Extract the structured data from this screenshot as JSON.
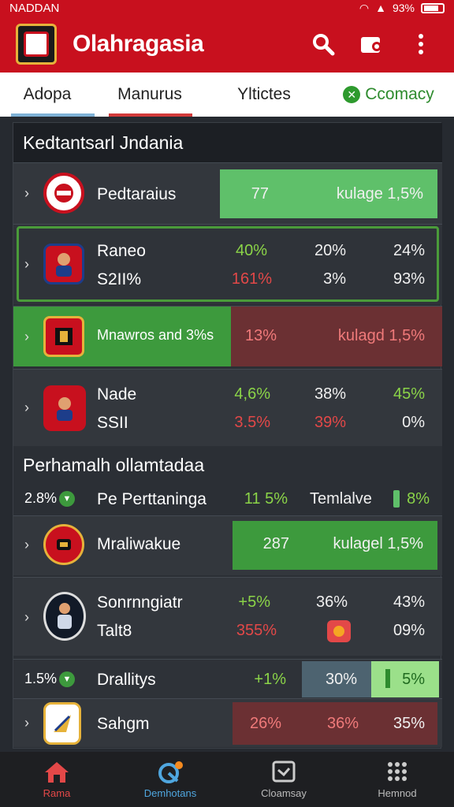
{
  "status": {
    "carrier": "NADDAN",
    "battery": "93%"
  },
  "app": {
    "title": "Olahragasia"
  },
  "tabs": [
    "Adopa",
    "Manurus",
    "Yltictes",
    "Ccomacy"
  ],
  "sections": [
    {
      "title": "Kedtantsarl Jndania"
    },
    {
      "title": "Perhamalh ollamtadaa"
    }
  ],
  "rows": {
    "r1": {
      "name": "Pedtaraius",
      "v1": "77",
      "v2": "kulage 1,5%"
    },
    "r2": {
      "name": "Raneo",
      "sub": "S2II%",
      "v1": "40%",
      "v2": "20%",
      "v3": "24%",
      "w1": "161%",
      "w2": "3%",
      "w3": "93%"
    },
    "r3": {
      "name": "Mnawros and 3%s",
      "v1": "13%",
      "v2": "kulagd 1,5%"
    },
    "r4": {
      "name": "Nade",
      "sub": "SSII",
      "v1": "4,6%",
      "v2": "38%",
      "v3": "45%",
      "w1": "3.5%",
      "w2": "39%",
      "w3": "0%"
    },
    "r5": {
      "lead": "2.8%",
      "name": "Pe Perttaninga",
      "v1": "11 5%",
      "v2": "Temlalve",
      "v3": "8%"
    },
    "r6": {
      "name": "Mraliwakue",
      "v1": "287",
      "v2": "kulagel 1,5%"
    },
    "r7": {
      "name": "Sonrnngiatr",
      "sub": "Talt8",
      "v1": "+5%",
      "v2": "36%",
      "v3": "43%",
      "w1": "355%",
      "w3": "09%"
    },
    "r8": {
      "lead": "1.5%",
      "name": "Drallitys",
      "v1": "+1%",
      "v2": "30%",
      "v3": "5%"
    },
    "r9": {
      "name": "Sahgm",
      "v1": "26%",
      "v2": "36%",
      "v3": "35%"
    }
  },
  "nav": [
    "Rama",
    "Demhotans",
    "Cloamsay",
    "Hemnod"
  ],
  "colors": {
    "brand": "#c8101e",
    "accent_green": "#5fc06a",
    "accent_red": "#e34848"
  }
}
